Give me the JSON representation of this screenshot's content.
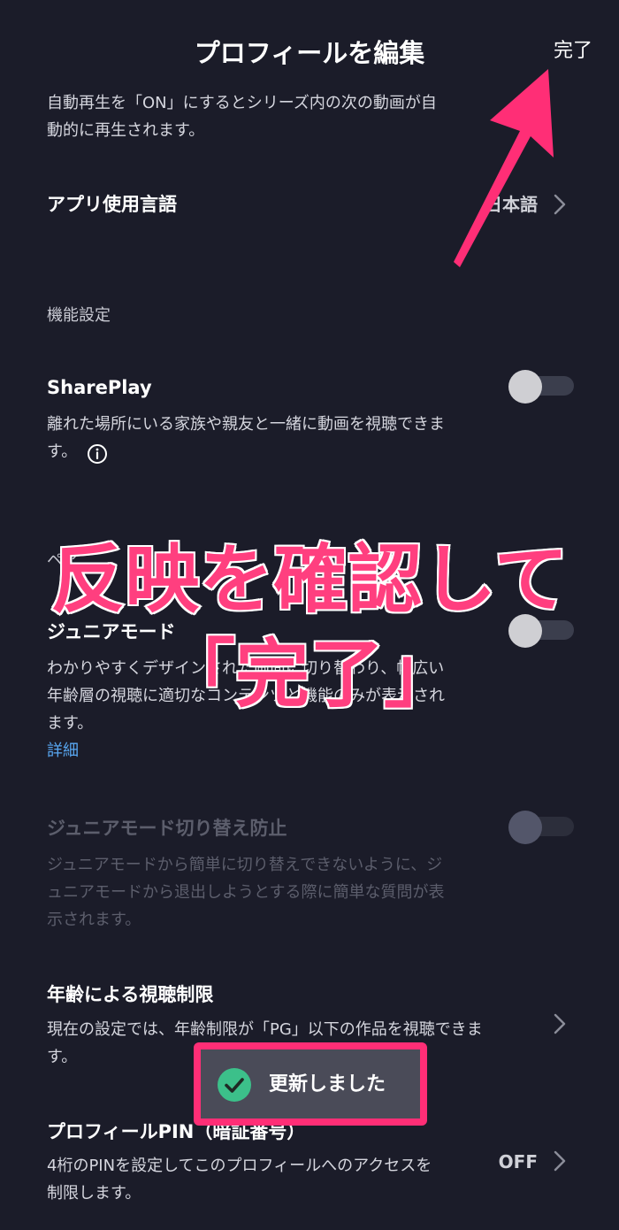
{
  "header": {
    "title": "プロフィールを編集",
    "done_label": "完了"
  },
  "autoplay": {
    "desc_line1": "自動再生を「ON」にするとシリーズ内の次の動画が自",
    "desc_line2": "動的に再生されます。"
  },
  "language": {
    "label": "アプリ使用言語",
    "value": "日本語"
  },
  "features": {
    "section_title": "機能設定",
    "shareplay": {
      "label": "SharePlay",
      "desc_line1": "離れた場所にいる家族や親友と一緒に動画を視聴できま",
      "desc_line2": "す。",
      "enabled": false
    },
    "pair_section_title": "ペア",
    "junior_mode": {
      "label": "ジュニアモード",
      "desc_line1": "わかりやすくデザインされた画面に切り替わり、幅広い",
      "desc_line2": "年齢層の視聴に適切なコンテンツと機能のみが表示され",
      "desc_line3": "ます。",
      "link": "詳細",
      "enabled": false
    },
    "junior_lock": {
      "label": "ジュニアモード切り替え防止",
      "desc_line1": "ジュニアモードから簡単に切り替えできないように、ジ",
      "desc_line2": "ュニアモードから退出しようとする際に簡単な質問が表",
      "desc_line3": "示されます。",
      "enabled": false
    },
    "age_limit": {
      "label": "年齢による視聴制限",
      "desc_line1": "現在の設定では、年齢制限が「PG」以下の作品を視聴できま",
      "desc_line2": "す。"
    },
    "profile_pin": {
      "label": "プロフィールPIN（暗証番号）",
      "desc_line1": "4桁のPINを設定してこのプロフィールへのアクセスを",
      "desc_line2": "制限します。",
      "value": "OFF"
    }
  },
  "toast": {
    "message": "更新しました"
  },
  "annotation": {
    "line1": "反映を確認して",
    "line2": "「完了」"
  },
  "colors": {
    "background": "#1b1c29",
    "accent_pink": "#ff2e76",
    "link_blue": "#58a7f2",
    "toast_check": "#3cc08a"
  }
}
